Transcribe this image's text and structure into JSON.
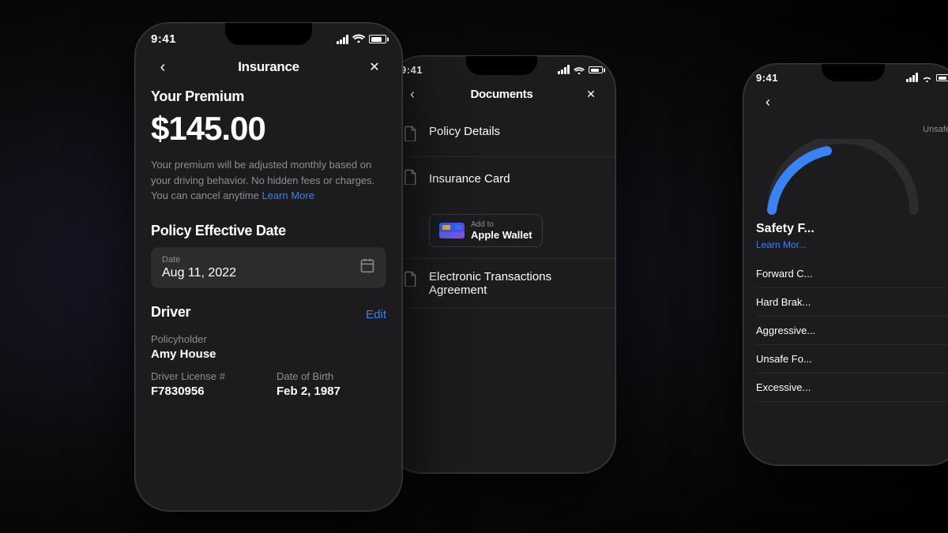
{
  "scene": {
    "bg": "#000000"
  },
  "phone_main": {
    "status": {
      "time": "9:41",
      "signal": "signal-bars",
      "wifi": "wifi",
      "battery": "battery"
    },
    "nav": {
      "back_icon": "‹",
      "title": "Insurance",
      "close_icon": "✕"
    },
    "premium": {
      "label": "Your Premium",
      "amount": "$145.00",
      "description": "Your premium will be adjusted monthly based on your driving behavior. No hidden fees or charges. You can cancel anytime",
      "learn_more": "Learn More"
    },
    "policy_date": {
      "label": "Policy Effective Date",
      "field_label": "Date",
      "value": "Aug 11, 2022"
    },
    "driver": {
      "label": "Driver",
      "edit": "Edit",
      "policyholder_label": "Policyholder",
      "policyholder_value": "Amy House",
      "license_label": "Driver License #",
      "license_value": "F7830956",
      "dob_label": "Date of Birth",
      "dob_value": "Feb 2, 1987"
    }
  },
  "phone_mid": {
    "status": {
      "time": "9:41"
    },
    "nav": {
      "back_icon": "‹",
      "title": "Documents",
      "close_icon": "✕"
    },
    "docs": [
      {
        "icon": "📄",
        "label": "Policy Details"
      },
      {
        "icon": "📄",
        "label": "Insurance Card",
        "wallet": {
          "add": "Add to",
          "label": "Apple Wallet"
        }
      },
      {
        "icon": "📄",
        "label": "Electronic Transactions Agreement"
      }
    ]
  },
  "phone_right": {
    "status": {
      "time": "9:41"
    },
    "nav": {
      "back_icon": "‹"
    },
    "safety": {
      "title": "Safety F...",
      "learn_more": "Learn Mor...",
      "items": [
        {
          "label": "Forward C..."
        },
        {
          "label": "Hard Brak..."
        },
        {
          "label": "Aggressive..."
        },
        {
          "label": "Unsafe Fo..."
        },
        {
          "label": "Excessive..."
        }
      ]
    }
  }
}
